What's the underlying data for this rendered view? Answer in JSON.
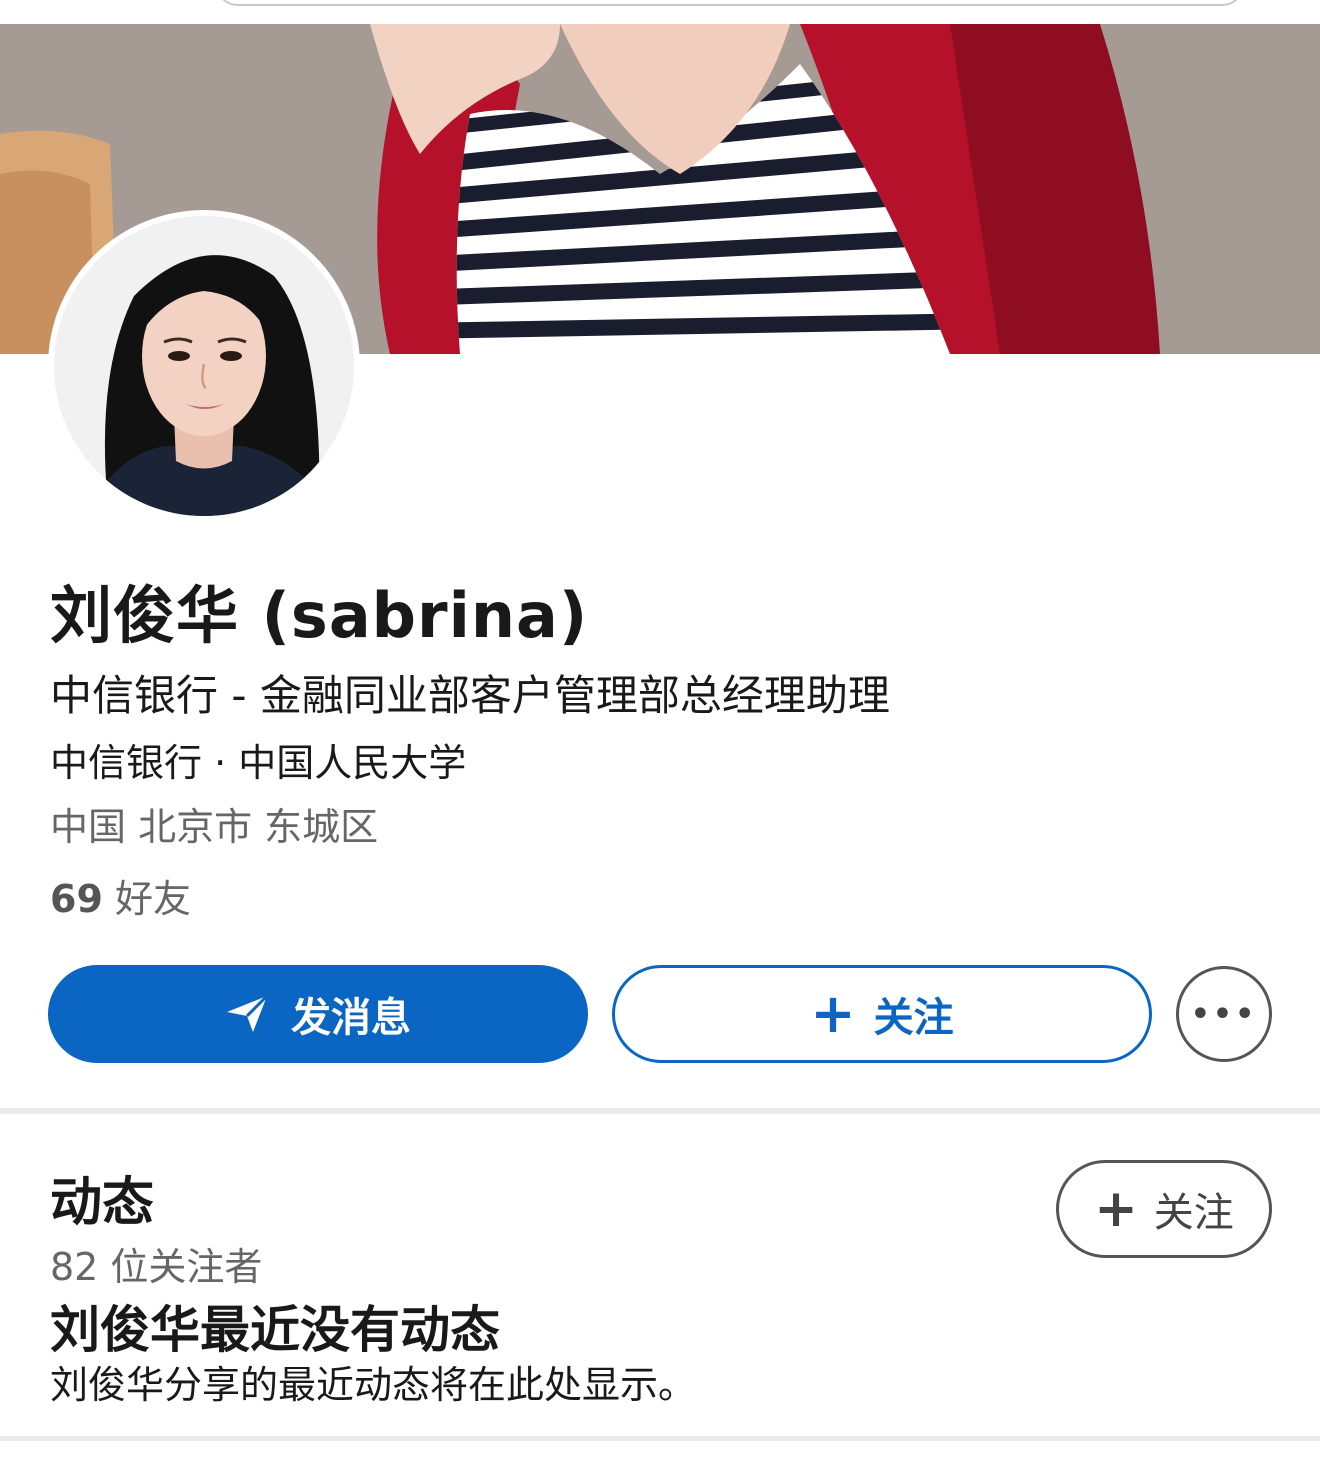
{
  "profile": {
    "name": "刘俊华 (sabrina)",
    "headline": "中信银行 - 金融同业部客户管理部总经理助理",
    "education": "中信银行 · 中国人民大学",
    "location": "中国 北京市 东城区",
    "friends_count": "69",
    "friends_label": "好友"
  },
  "actions": {
    "message_label": "发消息",
    "follow_label": "关注",
    "more_label": "•••"
  },
  "activity": {
    "title": "动态",
    "followers": "82 位关注者",
    "follow_label": "关注",
    "empty_title": "刘俊华最近没有动态",
    "empty_desc": "刘俊华分享的最近动态将在此处显示。"
  },
  "icons": {
    "message": "send-icon",
    "follow": "plus-icon",
    "more": "more-icon"
  },
  "colors": {
    "primary": "#0a66c2",
    "text": "#191919",
    "muted": "#666666"
  }
}
